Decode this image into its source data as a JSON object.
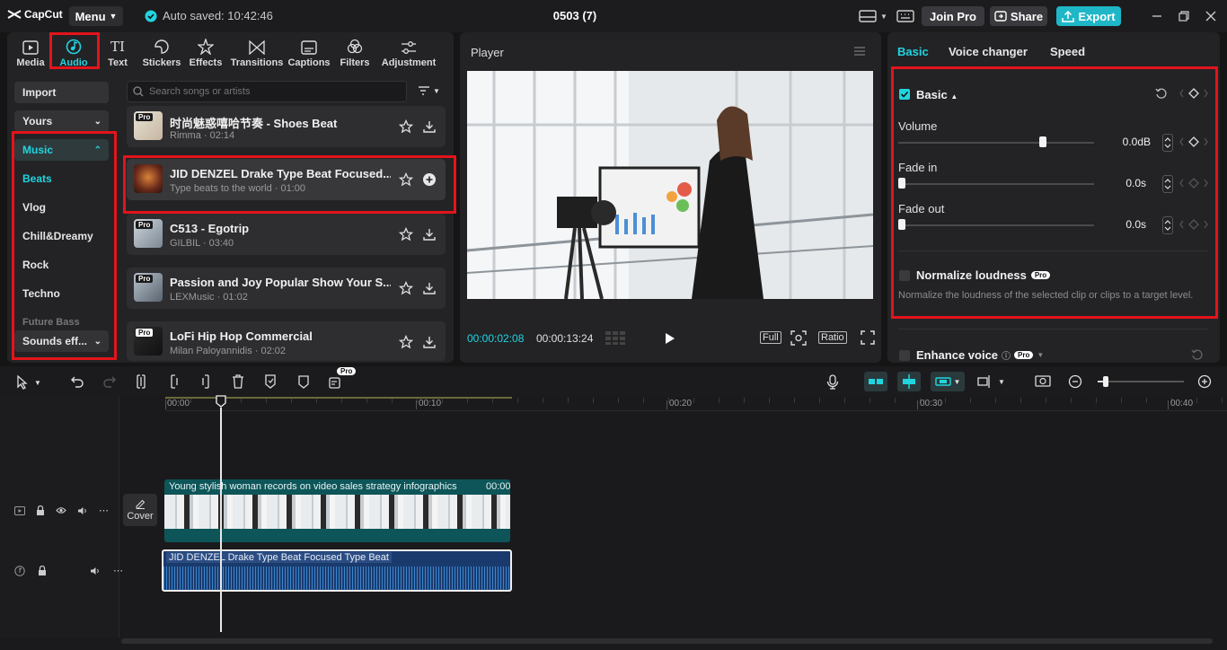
{
  "titlebar": {
    "app_name": "CapCut",
    "menu_label": "Menu",
    "autosave": "Auto saved: 10:42:46",
    "project_title": "0503 (7)",
    "join_pro": "Join Pro",
    "share": "Share",
    "export": "Export"
  },
  "toolbar": {
    "tools": [
      {
        "label": "Media",
        "icon": "media-icon"
      },
      {
        "label": "Audio",
        "icon": "audio-icon"
      },
      {
        "label": "Text",
        "icon": "text-icon"
      },
      {
        "label": "Stickers",
        "icon": "stickers-icon"
      },
      {
        "label": "Effects",
        "icon": "effects-icon"
      },
      {
        "label": "Transitions",
        "icon": "transitions-icon"
      },
      {
        "label": "Captions",
        "icon": "captions-icon"
      },
      {
        "label": "Filters",
        "icon": "filters-icon"
      },
      {
        "label": "Adjustment",
        "icon": "adjustment-icon"
      }
    ],
    "active": "Audio"
  },
  "sidebar": {
    "import": "Import",
    "yours": "Yours",
    "music": "Music",
    "items": [
      "Beats",
      "Vlog",
      "Chill&Dreamy",
      "Rock",
      "Techno",
      "Future Bass"
    ],
    "sounds": "Sounds eff..."
  },
  "search": {
    "placeholder": "Search songs or artists"
  },
  "tracks": [
    {
      "title": "时尚魅惑嘻哈节奏 - Shoes Beat",
      "subtitle": "Rimma · 02:14",
      "pro": true,
      "action": "download"
    },
    {
      "title": "JID DENZEL Drake Type Beat Focused...",
      "subtitle": "Type beats to the world · 01:00",
      "pro": false,
      "action": "add"
    },
    {
      "title": "C513 - Egotrip",
      "subtitle": "GILBIL · 03:40",
      "pro": true,
      "action": "download"
    },
    {
      "title": "Passion and Joy Popular Show Your S...",
      "subtitle": "LEXMusic · 01:02",
      "pro": true,
      "action": "download"
    },
    {
      "title": "LoFi Hip Hop Commercial",
      "subtitle": "Milan Paloyannidis · 02:02",
      "pro": true,
      "action": "download"
    }
  ],
  "pro_badge": "Pro",
  "player": {
    "title": "Player",
    "current_time": "00:00:02:08",
    "total_time": "00:00:13:24",
    "full": "Full",
    "ratio": "Ratio"
  },
  "inspector": {
    "tabs": [
      "Basic",
      "Voice changer",
      "Speed"
    ],
    "section": "Basic",
    "volume_label": "Volume",
    "volume_value": "0.0dB",
    "fade_in_label": "Fade in",
    "fade_in_value": "0.0s",
    "fade_out_label": "Fade out",
    "fade_out_value": "0.0s",
    "normalize_label": "Normalize loudness",
    "normalize_desc": "Normalize the loudness of the selected clip or clips to a target level.",
    "enhance_label": "Enhance voice"
  },
  "timeline": {
    "ticks": [
      "00:00",
      "00:10",
      "00:20",
      "00:30",
      "00:40"
    ],
    "cover_label": "Cover",
    "video_clip_title": "Young stylish woman records on video sales strategy infographics",
    "video_clip_time": "00:00",
    "audio_clip_title": "JID DENZEL Drake Type Beat Focused Type Beat"
  },
  "colors": {
    "accent": "#20d5e0",
    "highlight": "#e3141b",
    "video_clip": "#0e5a5e",
    "audio_clip": "#1a3a6e"
  }
}
